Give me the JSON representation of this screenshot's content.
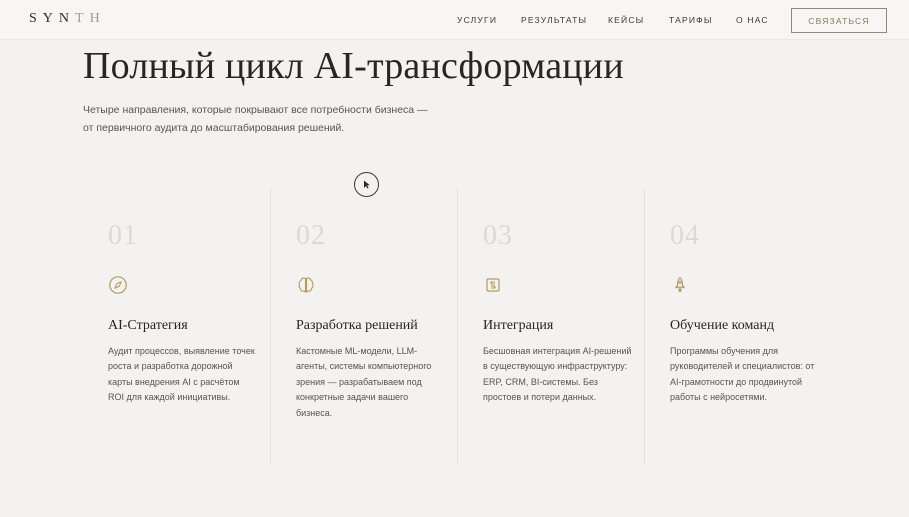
{
  "header": {
    "logo_main": "SYN",
    "logo_accent": "TH",
    "nav": [
      {
        "label": "Услуги"
      },
      {
        "label": "Результаты"
      },
      {
        "label": "Кейсы"
      },
      {
        "label": "Тарифы"
      },
      {
        "label": "О нас"
      }
    ],
    "cta_label": "Связаться"
  },
  "hero": {
    "title": "Полный цикл AI-трансформации",
    "subtitle": "Четыре направления, которые покрывают все потребности бизнеса — от первичного аудита до масштабирования решений."
  },
  "services": [
    {
      "number": "01",
      "icon": "compass-icon",
      "title": "AI-Стратегия",
      "text": "Аудит процессов, выявление точек роста и разработка дорожной карты внедрения AI с расчётом ROI для каждой инициативы."
    },
    {
      "number": "02",
      "icon": "brain-icon",
      "title": "Разработка решений",
      "text": "Кастомные ML-модели, LLM-агенты, системы компьютерного зрения — разрабатываем под конкретные задачи вашего бизнеса."
    },
    {
      "number": "03",
      "icon": "integration-icon",
      "title": "Интеграция",
      "text": "Бесшовная интеграция AI-решений в существующую инфраструктуру: ERP, CRM, BI-системы. Без простоев и потери данных."
    },
    {
      "number": "04",
      "icon": "rocket-icon",
      "title": "Обучение команд",
      "text": "Программы обучения для руководителей и специалистов: от AI-грамотности до продвинутой работы с нейросетями."
    }
  ],
  "colors": {
    "accent": "#b69a5c",
    "background": "#f3f2f0",
    "text": "#262626"
  }
}
